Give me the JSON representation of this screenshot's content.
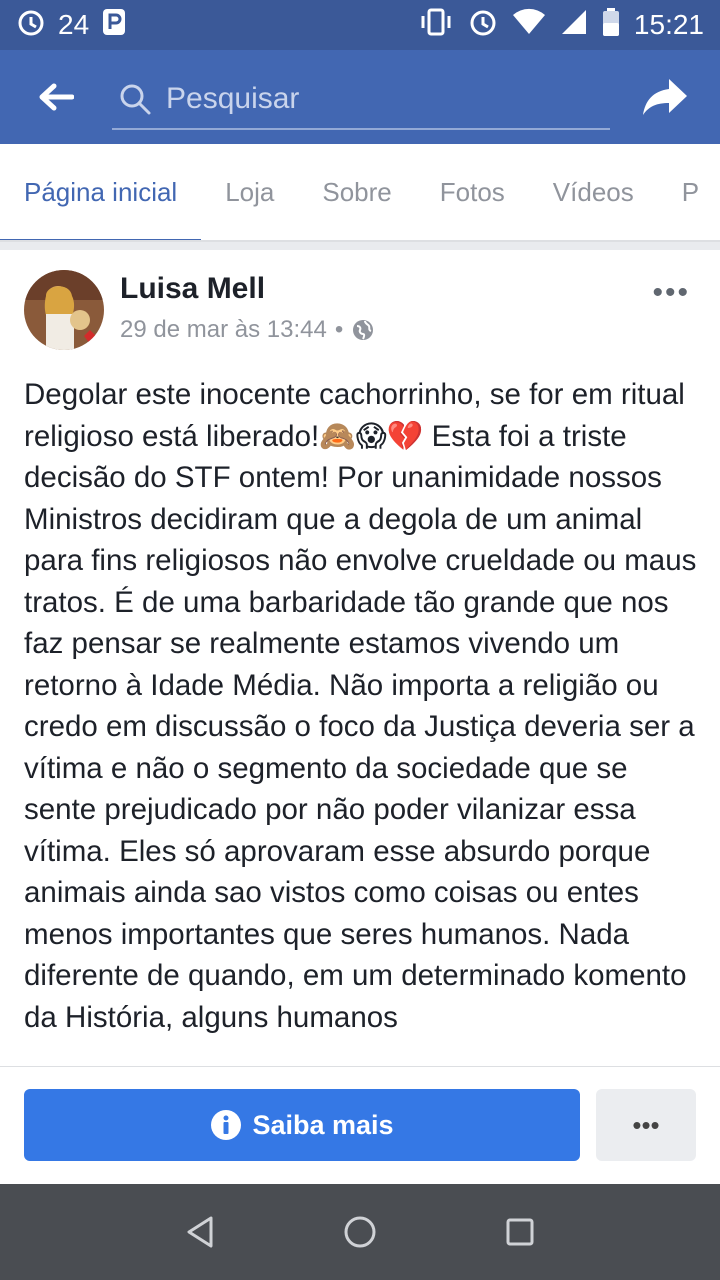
{
  "status_bar": {
    "temperature": "24",
    "time": "15:21",
    "icons": [
      "alarm-icon",
      "p-notification-icon",
      "vibrate-icon",
      "alarm-icon",
      "wifi-icon",
      "signal-icon",
      "battery-icon"
    ]
  },
  "app_bar": {
    "search_placeholder": "Pesquisar",
    "icons": [
      "back-arrow-icon",
      "search-icon",
      "share-icon"
    ]
  },
  "tabs": [
    {
      "label": "Página inicial",
      "active": true
    },
    {
      "label": "Loja",
      "active": false
    },
    {
      "label": "Sobre",
      "active": false
    },
    {
      "label": "Fotos",
      "active": false
    },
    {
      "label": "Vídeos",
      "active": false
    },
    {
      "label": "P",
      "active": false
    }
  ],
  "post": {
    "author": "Luisa Mell",
    "timestamp": "29 de mar às 13:44",
    "separator": "•",
    "more": "•••",
    "text": "Degolar este inocente cachorrinho, se for em ritual religioso está liberado!🙈😱💔 Esta foi a triste decisão do STF ontem!  Por unanimidade nossos Ministros decidiram que a degola de um animal para fins religiosos não envolve crueldade ou maus tratos. É de uma barbaridade tão grande que nos faz pensar se realmente estamos vivendo um retorno à Idade Média. Não importa a religião ou credo em discussão o foco da Justiça deveria ser a vítima e não o segmento da sociedade que se sente prejudicado por não poder vilanizar essa vítima. Eles só aprovaram esse absurdo porque animais ainda sao vistos como coisas ou entes menos importantes que seres humanos. Nada diferente de quando, em um determinado komento da História, alguns humanos"
  },
  "cta": {
    "button_label": "Saiba mais",
    "more_label": "•••"
  },
  "colors": {
    "brand": "#4267b2",
    "status_bar": "#3b5998",
    "cta_button": "#3578e5",
    "nav_bar": "#4a4d52"
  }
}
